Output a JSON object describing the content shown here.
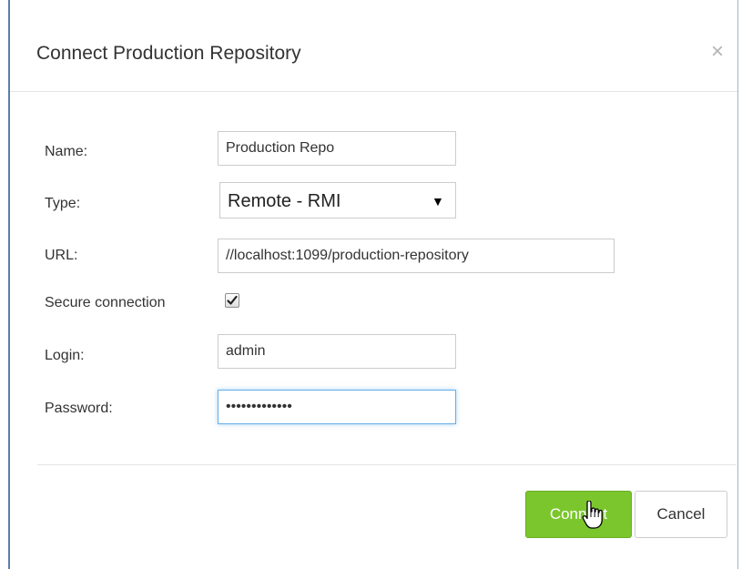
{
  "dialog": {
    "title": "Connect Production Repository",
    "close_symbol": "×"
  },
  "form": {
    "name": {
      "label": "Name:",
      "value": "Production Repo"
    },
    "type": {
      "label": "Type:",
      "selected": "Remote - RMI",
      "arrow": "▼"
    },
    "url": {
      "label": "URL:",
      "value": "//localhost:1099/production-repository"
    },
    "secure": {
      "label": "Secure connection",
      "checked": true
    },
    "login": {
      "label": "Login:",
      "value": "admin"
    },
    "password": {
      "label": "Password:",
      "value": "•••••••••••••"
    }
  },
  "buttons": {
    "connect": "Connect",
    "cancel": "Cancel"
  },
  "colors": {
    "primary": "#7bc62d",
    "focus": "#66afe9",
    "window_border": "#5a7ea7"
  }
}
